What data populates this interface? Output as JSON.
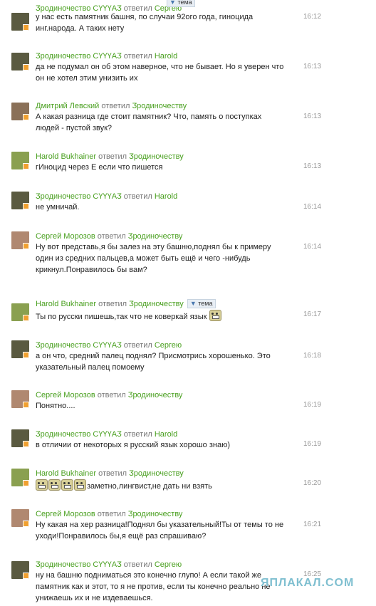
{
  "messages": [
    {
      "author": "Ӡродиночество СҮҮҮАӠ",
      "reply_word": "ответил",
      "target": "Сергею",
      "text": "у нас есть памятник башня, по случаи 92ого года, гиноцида инг.народа. А таких нету",
      "time": "16:12",
      "avatar": "dark",
      "tema": "тема"
    },
    {
      "author": "Ӡродиночество СҮҮҮАӠ",
      "reply_word": "ответил",
      "target": "Harold",
      "text": "да не подумал он об этом наверное, что не бывает. Но я уверен что он не хотел этим унизить их",
      "time": "16:13",
      "avatar": "dark"
    },
    {
      "author": "Дмитрий Левский",
      "reply_word": "ответил",
      "target": "Ӡродиночеству",
      "text": "А какая разница где стоит памятник? Что, память о поступках людей - пустой звук?",
      "time": "16:13",
      "avatar": "man"
    },
    {
      "author": "Harold Bukhainer",
      "reply_word": "ответил",
      "target": "Ӡродиночеству",
      "text": "гИноцид через Е если что пишется",
      "time": "16:13",
      "avatar": "field"
    },
    {
      "author": "Ӡродиночество СҮҮҮАӠ",
      "reply_word": "ответил",
      "target": "Harold",
      "text": "не умничай.",
      "time": "16:14",
      "avatar": "dark"
    },
    {
      "author": "Сергей Морозов",
      "reply_word": "ответил",
      "target": "Ӡродиночеству",
      "text": "Ну вот представь,я бы залез на эту башню,поднял бы к примеру один из средних пальцев,а может быть ещё и чего -нибудь крикнул.Понравилось бы вам?",
      "time": "16:14",
      "avatar": "face"
    },
    {
      "author": "Harold Bukhainer",
      "reply_word": "ответил",
      "target": "Ӡродиночеству",
      "text": "Ты по русски пишешь,так что не коверкай язык",
      "time": "16:17",
      "avatar": "field",
      "tema": "тема"
    },
    {
      "author": "Ӡродиночество СҮҮҮАӠ",
      "reply_word": "ответил",
      "target": "Сергею",
      "text": "а он что, средний палец поднял? Присмотрись хорошенько. Это указательный палец помоему",
      "time": "16:18",
      "avatar": "dark"
    },
    {
      "author": "Сергей Морозов",
      "reply_word": "ответил",
      "target": "Ӡродиночеству",
      "text": "Понятно....",
      "time": "16:19",
      "avatar": "face"
    },
    {
      "author": "Ӡродиночество СҮҮҮАӠ",
      "reply_word": "ответил",
      "target": "Harold",
      "text": "в отличии от некоторых я русский язык хорошо знаю)",
      "time": "16:19",
      "avatar": "dark"
    },
    {
      "author": "Harold Bukhainer",
      "reply_word": "ответил",
      "target": "Ӡродиночеству",
      "text": "заметно,лингвист,не дать ни взять",
      "time": "16:20",
      "avatar": "field"
    },
    {
      "author": "Сергей Морозов",
      "reply_word": "ответил",
      "target": "Ӡродиночеству",
      "text": "Ну какая на хер разница!Поднял бы указательный!Ты от темы то не уходи!Понравилось бы,я ещё раз спрашиваю?",
      "time": "16:21",
      "avatar": "face"
    },
    {
      "author": "Ӡродиночество СҮҮҮАӠ",
      "reply_word": "ответил",
      "target": "Сергею",
      "text": "ну на башню подниматься это конечно глупо! А если такой же памятник как и этот, то я не против, если ты конечно реально не унижаешь их и не издеваешься.",
      "time": "16:25",
      "avatar": "dark"
    }
  ],
  "watermark": "ЯПЛАКАЛ.COM"
}
